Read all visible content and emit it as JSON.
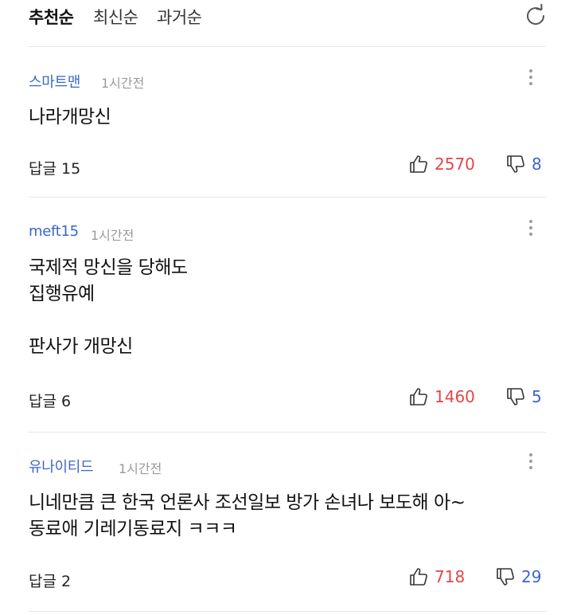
{
  "sort": {
    "recommended": "추천순",
    "latest": "최신순",
    "oldest": "과거순"
  },
  "comments": [
    {
      "author": "스마트맨",
      "time": "1시간전",
      "text": "나라개망신",
      "reply": "답글 15",
      "likes": "2570",
      "dislikes": "8"
    },
    {
      "author": "meft15",
      "time": "1시간전",
      "text": "국제적 망신을 당해도\n집행유예\n\n판사가 개망신",
      "reply": "답글 6",
      "likes": "1460",
      "dislikes": "5"
    },
    {
      "author": "유나이티드",
      "time": "1시간전",
      "text": "니네만큼 큰 한국 언론사 조선일보 방가 손녀나 보도해 아~\n동료애 기레기동료지 ㅋㅋㅋ",
      "reply": "답글 2",
      "likes": "718",
      "dislikes": "29"
    }
  ],
  "colors": {
    "author": "#3b67c9",
    "likes": "#e5454a",
    "dislikes": "#3b67c9"
  },
  "icons": [
    "refresh-icon",
    "more-vertical-icon",
    "thumbs-up-icon",
    "thumbs-down-icon"
  ]
}
